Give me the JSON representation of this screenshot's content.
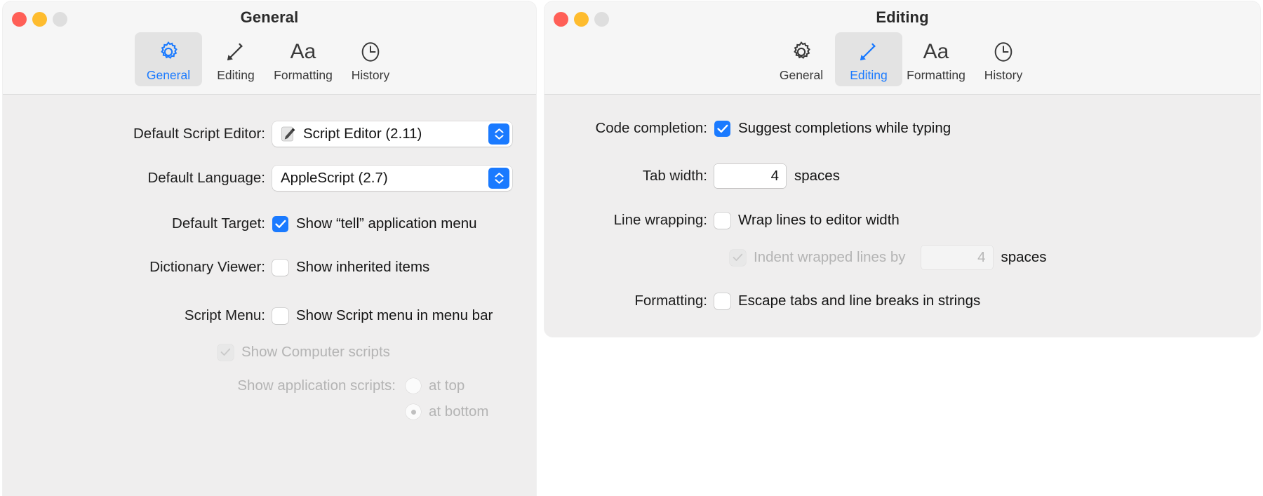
{
  "windows": {
    "general": {
      "title": "General",
      "traffic": {
        "close": "close-button",
        "minimize": "minimize-button",
        "zoom": "zoom-button"
      },
      "tabs": [
        {
          "label": "General",
          "icon": "gear-icon",
          "selected": true
        },
        {
          "label": "Editing",
          "icon": "pencil-icon",
          "selected": false
        },
        {
          "label": "Formatting",
          "icon": "aa-icon",
          "selected": false
        },
        {
          "label": "History",
          "icon": "clock-icon",
          "selected": false
        }
      ],
      "aa_glyph": "Aa",
      "fields": {
        "default_script_editor": {
          "label": "Default Script Editor:",
          "value": "Script Editor (2.11)",
          "icon": "script-editor-app-icon"
        },
        "default_language": {
          "label": "Default Language:",
          "value": "AppleScript (2.7)"
        },
        "default_target": {
          "label": "Default Target:",
          "checkbox_label": "Show “tell” application menu",
          "checked": true
        },
        "dictionary_viewer": {
          "label": "Dictionary Viewer:",
          "checkbox_label": "Show inherited items",
          "checked": false
        },
        "script_menu": {
          "label": "Script Menu:",
          "checkbox_label": "Show Script menu in menu bar",
          "checked": false,
          "sub_checkbox_label": "Show Computer scripts",
          "sub_checked": true,
          "sub_disabled": true,
          "radio_group_label": "Show application scripts:",
          "radio_options": [
            {
              "label": "at top",
              "selected": false
            },
            {
              "label": "at bottom",
              "selected": true
            }
          ],
          "radio_disabled": true
        }
      }
    },
    "editing": {
      "title": "Editing",
      "traffic": {
        "close": "close-button",
        "minimize": "minimize-button",
        "zoom": "zoom-button"
      },
      "tabs": [
        {
          "label": "General",
          "icon": "gear-icon",
          "selected": false
        },
        {
          "label": "Editing",
          "icon": "pencil-icon",
          "selected": true
        },
        {
          "label": "Formatting",
          "icon": "aa-icon",
          "selected": false
        },
        {
          "label": "History",
          "icon": "clock-icon",
          "selected": false
        }
      ],
      "aa_glyph": "Aa",
      "fields": {
        "code_completion": {
          "label": "Code completion:",
          "checkbox_label": "Suggest completions while typing",
          "checked": true
        },
        "tab_width": {
          "label": "Tab width:",
          "value": "4",
          "suffix": "spaces"
        },
        "line_wrapping": {
          "label": "Line wrapping:",
          "checkbox_label": "Wrap lines to editor width",
          "checked": false,
          "sub_checkbox_label": "Indent wrapped lines by",
          "sub_checked": true,
          "sub_disabled": true,
          "sub_value": "4",
          "sub_suffix": "spaces"
        },
        "formatting": {
          "label": "Formatting:",
          "checkbox_label": "Escape tabs and line breaks in strings",
          "checked": false
        }
      }
    }
  },
  "colors": {
    "accent": "#1a7aff",
    "close": "#ff5f57",
    "minimize": "#febc2e",
    "zoom": "#dedede",
    "window_bg": "#efeeee",
    "toolbar_bg": "#f6f6f6",
    "selected_tab_bg": "#e3e3e3",
    "disabled_text": "#b4b4b4"
  }
}
